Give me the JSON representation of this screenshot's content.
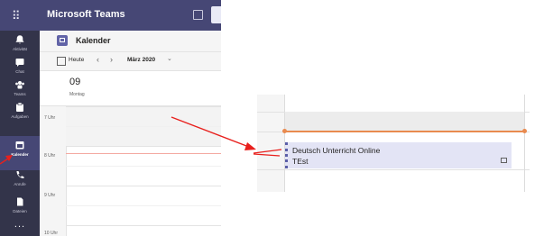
{
  "app": {
    "name": "Microsoft Teams",
    "grid_icon": "apps-grid-icon",
    "compose_icon": "compose-icon"
  },
  "rail": {
    "items": [
      {
        "label": "Aktivität",
        "icon": "bell-icon"
      },
      {
        "label": "Chat",
        "icon": "chat-icon"
      },
      {
        "label": "Teams",
        "icon": "teams-icon"
      },
      {
        "label": "Aufgaben",
        "icon": "assignments-icon"
      },
      {
        "label": "Kalender",
        "icon": "calendar-icon",
        "active": true
      },
      {
        "label": "Anrufe",
        "icon": "phone-icon"
      },
      {
        "label": "Dateien",
        "icon": "files-icon"
      }
    ],
    "more": "..."
  },
  "calendar": {
    "title": "Kalender",
    "toolbar": {
      "today": "Heute",
      "prev": "‹",
      "next": "›",
      "month": "März 2020",
      "chevron": "⌄"
    },
    "day": {
      "number": "09",
      "name": "Montag"
    },
    "times": [
      "7 Uhr",
      "8 Uhr",
      "9 Uhr",
      "10 Uhr"
    ]
  },
  "event": {
    "title": "Deutsch Unterricht Online",
    "subtitle": "TEst"
  },
  "colors": {
    "titlebar": "#464775",
    "rail": "#33344a",
    "accent": "#6264a7",
    "arrow": "#e8201d",
    "now_line": "#e98a4f",
    "event_bg": "#e3e4f5"
  }
}
